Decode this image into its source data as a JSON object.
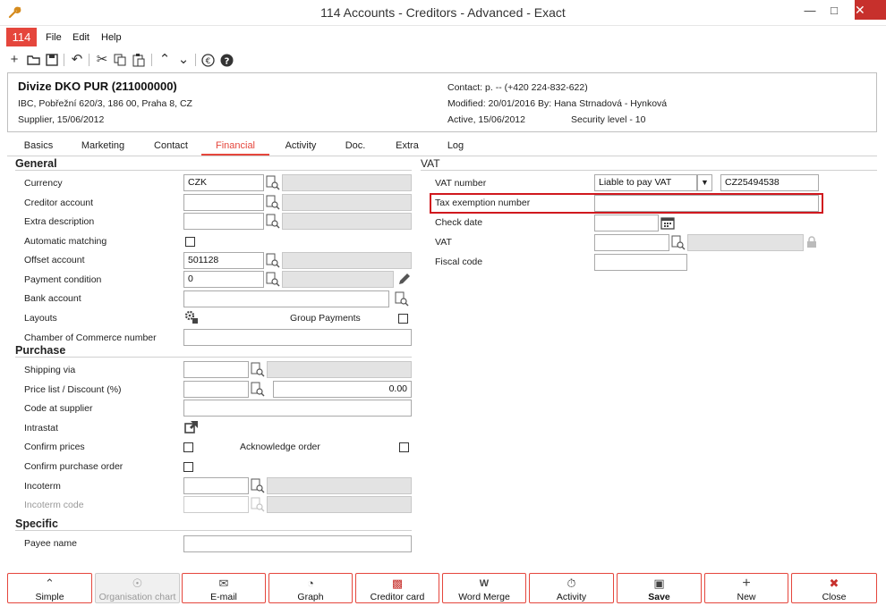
{
  "window": {
    "title": "114 Accounts - Creditors - Advanced - Exact",
    "app_badge": "114"
  },
  "menu": {
    "file": "File",
    "edit": "Edit",
    "help": "Help"
  },
  "header": {
    "name": "Divize DKO PUR (211000000)",
    "address": "IBC, Pobřežní 620/3, 186 00, Praha 8, CZ",
    "type": "Supplier, 15/06/2012",
    "contact": "Contact: p. -- (+420 224-832-622)",
    "modified": "Modified: 20/01/2016  By: Hana Strnadová - Hynková",
    "active": "Active, 15/06/2012",
    "security": "Security level - 10"
  },
  "tabs": [
    "Basics",
    "Marketing",
    "Contact",
    "Financial",
    "Activity",
    "Doc.",
    "Extra",
    "Log"
  ],
  "general": {
    "heading": "General",
    "currency_label": "Currency",
    "currency_value": "CZK",
    "creditor_account_label": "Creditor account",
    "extra_description_label": "Extra description",
    "automatic_matching_label": "Automatic matching",
    "offset_account_label": "Offset account",
    "offset_account_value": "501128",
    "payment_condition_label": "Payment condition",
    "payment_condition_value": "0",
    "bank_account_label": "Bank account",
    "layouts_label": "Layouts",
    "group_payments_label": "Group Payments",
    "chamber_label": "Chamber of Commerce number"
  },
  "purchase": {
    "heading": "Purchase",
    "shipping_via_label": "Shipping via",
    "price_list_label": "Price list / Discount (%)",
    "discount_value": "0.00",
    "code_at_supplier_label": "Code at supplier",
    "intrastat_label": "Intrastat",
    "confirm_prices_label": "Confirm prices",
    "acknowledge_order_label": "Acknowledge order",
    "confirm_purchase_order_label": "Confirm purchase order",
    "incoterm_label": "Incoterm",
    "incoterm_code_label": "Incoterm code"
  },
  "specific": {
    "heading": "Specific",
    "payee_name_label": "Payee name"
  },
  "vat": {
    "heading": "VAT",
    "vat_number_label": "VAT number",
    "vat_type_value": "Liable to pay VAT",
    "vat_number_value": "CZ25494538",
    "tax_exemption_label": "Tax exemption number",
    "check_date_label": "Check date",
    "vat_label": "VAT",
    "fiscal_code_label": "Fiscal code"
  },
  "buttons": {
    "simple": "Simple",
    "org_chart": "Organisation chart",
    "email": "E-mail",
    "graph": "Graph",
    "creditor_card": "Creditor card",
    "word_merge": "Word Merge",
    "activity": "Activity",
    "save": "Save",
    "new": "New",
    "close": "Close"
  },
  "colors": {
    "accent": "#e5463c",
    "highlight_border": "#d0181e"
  }
}
